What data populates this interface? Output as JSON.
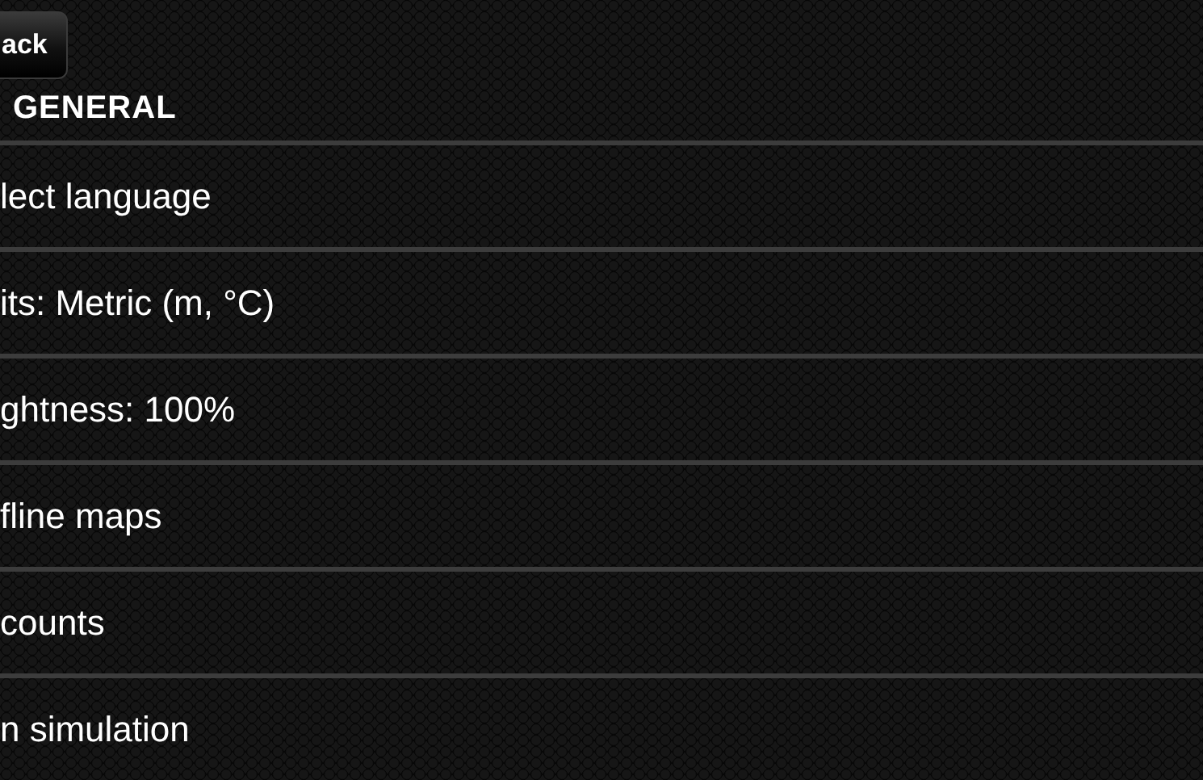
{
  "back_button": {
    "label": "ack"
  },
  "section": {
    "title": "GENERAL"
  },
  "items": [
    {
      "label": "lect language"
    },
    {
      "label": "its: Metric (m, °C)"
    },
    {
      "label": "ghtness: 100%"
    },
    {
      "label": "fline maps"
    },
    {
      "label": "counts"
    },
    {
      "label": "n simulation"
    }
  ]
}
